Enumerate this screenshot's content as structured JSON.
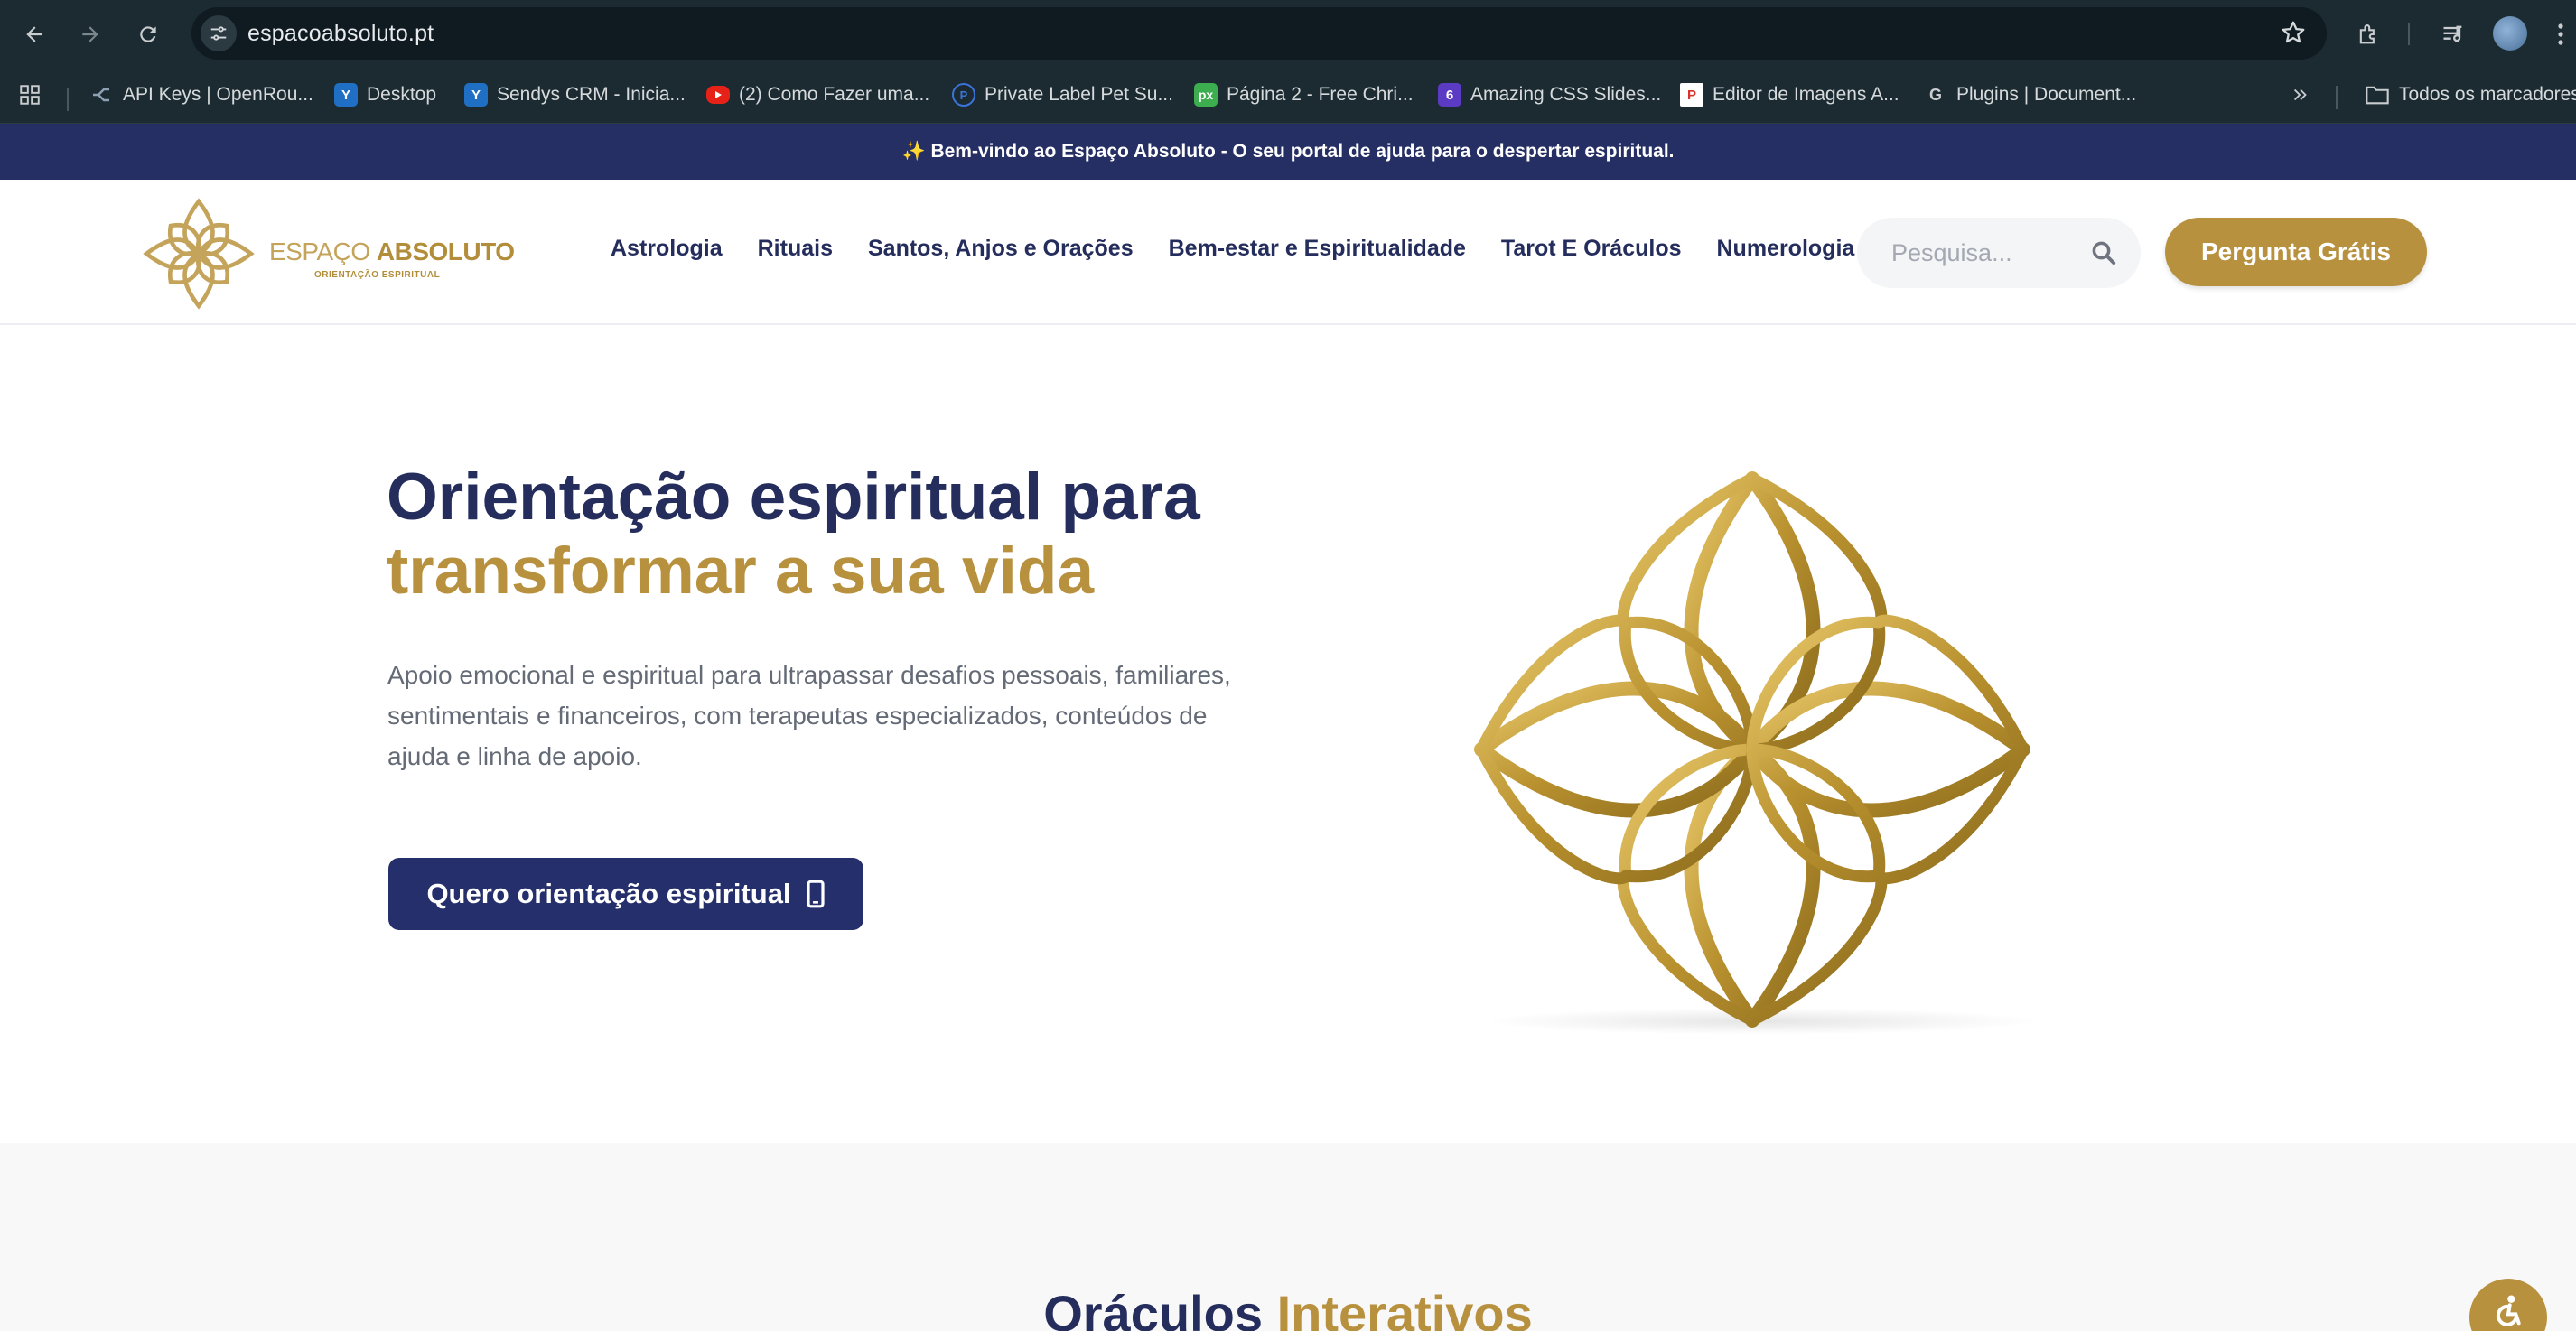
{
  "browser": {
    "url": "espacoabsoluto.pt",
    "bookmarks": [
      {
        "label": "API Keys | OpenRou...",
        "icon": "openrouter-icon",
        "color": "#8ea0b4"
      },
      {
        "label": "Desktop",
        "icon": "desktop-app-icon",
        "color": "#2a7bd4"
      },
      {
        "label": "Sendys CRM - Inicia...",
        "icon": "sendys-icon",
        "color": "#2a7bd4"
      },
      {
        "label": "(2) Como Fazer uma...",
        "icon": "youtube-icon",
        "color": "#e62117"
      },
      {
        "label": "Private Label Pet Su...",
        "icon": "private-label-icon",
        "color": "#3b73d9"
      },
      {
        "label": "Página 2 - Free Chri...",
        "icon": "pixabay-icon",
        "color": "#3cae4f"
      },
      {
        "label": "Amazing CSS Slides...",
        "icon": "six-icon",
        "color": "#5b3bc4"
      },
      {
        "label": "Editor de Imagens A...",
        "icon": "photopea-icon",
        "color": "#ffffff"
      },
      {
        "label": "Plugins | Document...",
        "icon": "google-icon",
        "color": "#1b2b31"
      }
    ],
    "all_bookmarks_label": "Todos os marcadores"
  },
  "site": {
    "announcement": "✨ Bem-vindo ao Espaço Absoluto - O seu portal de ajuda para o despertar espiritual.",
    "logo": {
      "word1": "ESPAÇO",
      "word2": "ABSOLUTO",
      "tagline": "ORIENTAÇÃO ESPIRITUAL"
    },
    "nav": [
      "Astrologia",
      "Rituais",
      "Santos, Anjos e Orações",
      "Bem-estar e Espiritualidade",
      "Tarot E Oráculos",
      "Numerologia"
    ],
    "search_placeholder": "Pesquisa...",
    "cta_label": "Pergunta Grátis",
    "hero": {
      "title_line1": "Orientação espiritual para",
      "title_line2": "transformar a sua vida",
      "description": "Apoio emocional e espiritual para ultrapassar desafios pessoais, familiares, sentimentais e financeiros, com terapeutas especializados, conteúdos de ajuda e linha de apoio.",
      "button_label": "Quero orientação espiritual"
    },
    "section2": {
      "title_part1": "Oráculos",
      "title_part2": "Interativos"
    },
    "colors": {
      "navy": "#242d5c",
      "gold": "#b8913f",
      "announce_bg": "#252f63"
    }
  }
}
